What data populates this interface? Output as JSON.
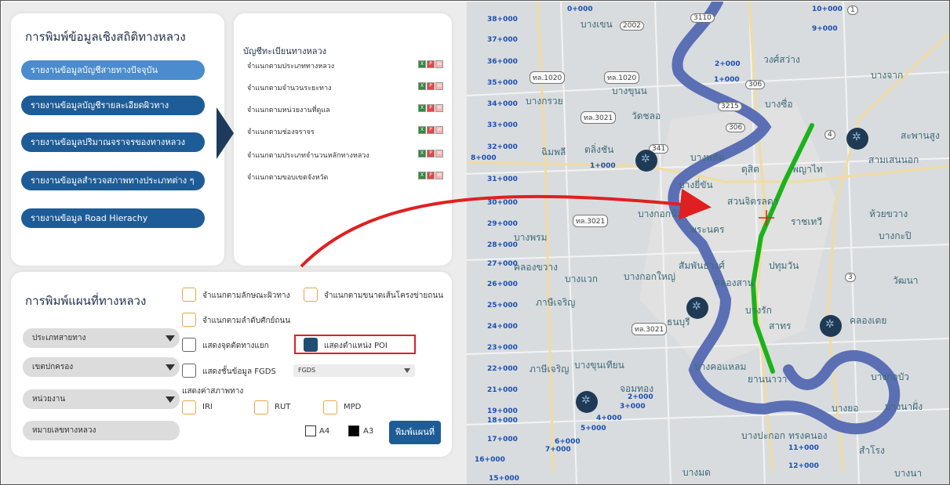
{
  "stats_card": {
    "title": "การพิมพ์ข้อมูลเชิงสถิติทางหลวง",
    "buttons": [
      "รายงานข้อมูลบัญชีสายทางปัจจุบัน",
      "รายงานข้อมูลบัญชีรายละเอียดผิวทาง",
      "รายงานข้อมูลปริมาณจราจรของทางหลวง",
      "รายงานข้อมูลสำรวจสภาพทางประเภทต่าง ๆ",
      "รายงานข้อมูล Road Hierachy"
    ]
  },
  "list_card": {
    "title": "บัญชีทะเบียนทางหลวง",
    "rows": [
      "จำแนกตามประเภททางหลวง",
      "จำแนกตามจำนวนระยะทาง",
      "จำแนกตามหน่วยงานที่ดูแล",
      "จำแนกตามช่องจราจร",
      "จำแนกตามประเภทจำนวนหลักทางหลวง",
      "จำแนกตามขอบเขตจังหวัด"
    ]
  },
  "map_card": {
    "title": "การพิมพ์แผนที่ทางหลวง",
    "dropdowns": [
      "ประเภทสายทาง",
      "เขตปกครอง",
      "หน่วยงาน",
      "หมายเลขทางหลวง"
    ],
    "opt_surface": "จำแนกตามลักษณะผิวทาง",
    "opt_network": "จำแนกตามขนาดเส้นโครงข่ายถนน",
    "opt_hierarchy": "จำแนกตามลำดับศักย์ถนน",
    "opt_intersection": "แสดงจุดตัดทางแยก",
    "opt_poi": "แสดงตำแหน่ง POI",
    "opt_fgds": "แสดงชั้นข้อมูล FGDS",
    "fgds_value": "FGDS",
    "condition_label": "แสดงค่าสภาพทาง",
    "cond_iri": "IRI",
    "cond_rut": "RUT",
    "cond_mpd": "MPD",
    "paper_a4": "A4",
    "paper_a3": "A3",
    "print_label": "พิมพ์แผนที่"
  },
  "map": {
    "places": [
      "บางพลัด",
      "ตลิ่งชัน",
      "ดุสิต",
      "บางกอกน้อย",
      "พระนคร",
      "สวนจิตรลดา",
      "ราชเทวี",
      "ปทุมวัน",
      "สัมพันธวงศ์",
      "บางกอกใหญ่",
      "คลองสาน",
      "บางรัก",
      "ภาษีเจริญ",
      "ธนบุรี",
      "สาทร",
      "คลองเตย",
      "จอมทอง",
      "บางคอแหลม",
      "ยานนาวา",
      "บางนา",
      "บางขุนเทียน",
      "วัฒนา",
      "ห้วยขวาง",
      "สะพานสูง",
      "ทรงคนอง",
      "บางจาก",
      "พญาไท",
      "วงศ์สว่าง",
      "บางซื่อ",
      "บางพรม",
      "บางกรวย",
      "บางขุนน",
      "บางยี่ขัน",
      "สามเสนนอก",
      "บางกะปิ",
      "สำโรง",
      "บางนาฝั่ง",
      "บางยอ",
      "บางกอบัว",
      "บางมด",
      "วัดชลอ",
      "ฉิมพลี",
      "บางแวก",
      "บางเขน",
      "บางปะกอก",
      "คลองขวาง",
      "ภาษีเจริญ"
    ],
    "road_numbers": [
      "ทล.1020",
      "ทล.1020",
      "ทล.3021",
      "ทล.3021",
      "3215",
      "306",
      "306",
      "2002",
      "3110",
      "341",
      "4",
      "3",
      "1",
      "ทล.3021"
    ],
    "km_marks": [
      "38+000",
      "37+000",
      "36+000",
      "35+000",
      "34+000",
      "33+000",
      "32+000",
      "31+000",
      "30+000",
      "29+000",
      "28+000",
      "27+000",
      "26+000",
      "25+000",
      "24+000",
      "23+000",
      "22+000",
      "21+000",
      "19+000",
      "18+000",
      "17+000",
      "16+000",
      "15+000",
      "8+000",
      "7+000",
      "6+000",
      "5+000",
      "4+000",
      "3+000",
      "2+000",
      "1+000",
      "0+000",
      "10+000",
      "9+000",
      "12+000",
      "11+000",
      "1+000",
      "2+000"
    ]
  },
  "colors": {
    "button_dark": "#1e5c97",
    "button_light": "#4a8ccd",
    "highlight_box": "#e02020",
    "route_line": "#1bb31b",
    "river": "#5b6fb5",
    "poi_pin": "#1f3a55",
    "checkbox_accent": "#e6a74a"
  },
  "icons": [
    "excel-icon",
    "pdf-icon",
    "word-icon",
    "poi-pin-icon",
    "chevron-right-icon",
    "dropdown-arrow-icon",
    "red-crosshair-icon",
    "red-arrow-annotation"
  ]
}
